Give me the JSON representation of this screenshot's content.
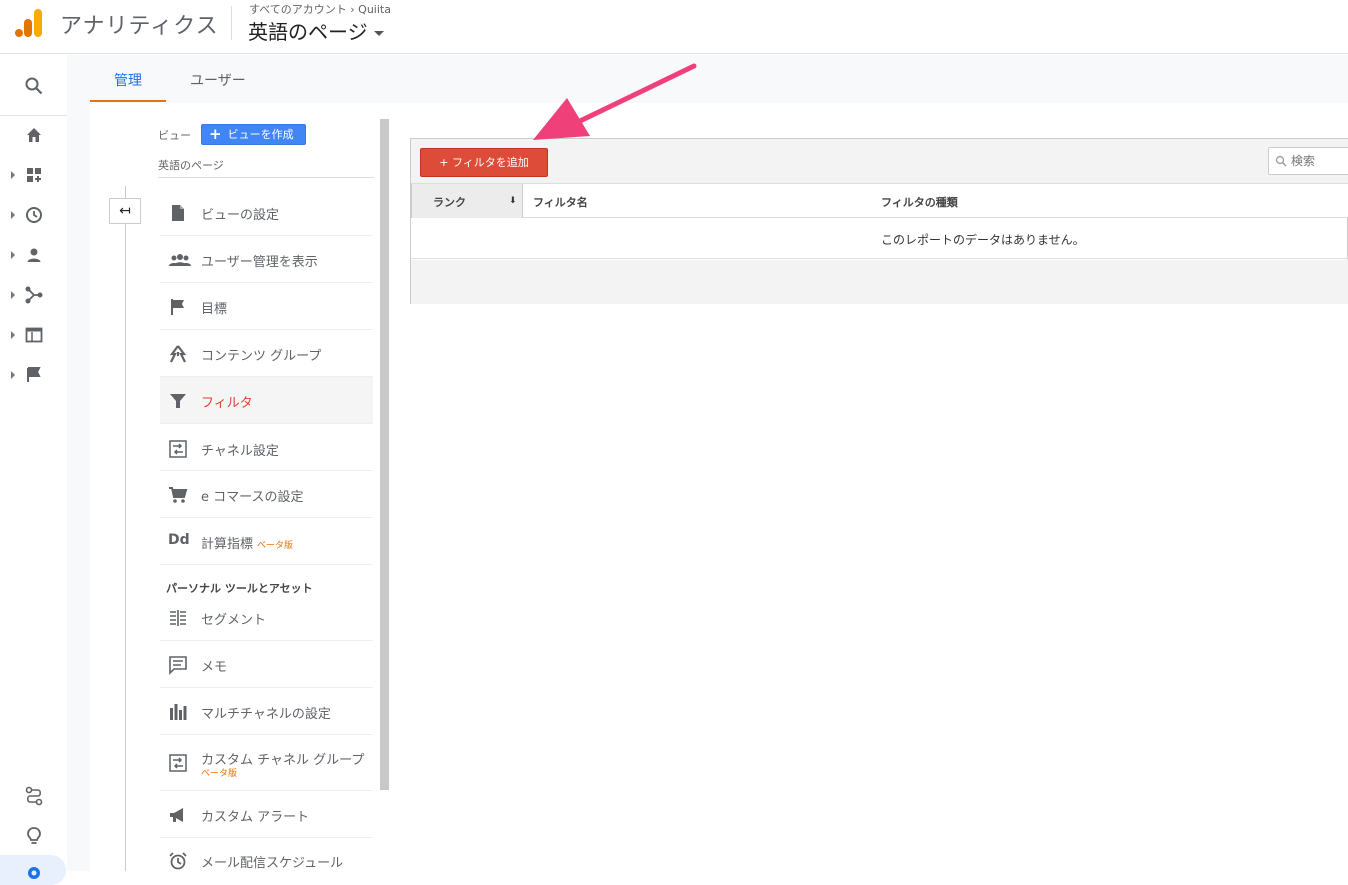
{
  "header": {
    "app_title": "アナリティクス",
    "breadcrumb": "すべてのアカウント › Quiita",
    "property_name": "英語のページ"
  },
  "tabs": [
    {
      "label": "管理",
      "active": true
    },
    {
      "label": "ユーザー",
      "active": false
    }
  ],
  "view_panel": {
    "view_label": "ビュー",
    "create_view_label": "ビューを作成",
    "view_name": "英語のページ",
    "section_personal": "パーソナル ツールとアセット",
    "beta_label": "ベータ版",
    "items": [
      {
        "label": "ビューの設定",
        "icon": "document-icon"
      },
      {
        "label": "ユーザー管理を表示",
        "icon": "people-icon"
      },
      {
        "label": "目標",
        "icon": "flag-icon"
      },
      {
        "label": "コンテンツ グループ",
        "icon": "content-group-icon"
      },
      {
        "label": "フィルタ",
        "icon": "filter-icon",
        "active": true
      },
      {
        "label": "チャネル設定",
        "icon": "channel-icon"
      },
      {
        "label": "e コマースの設定",
        "icon": "cart-icon"
      },
      {
        "label": "計算指標",
        "icon": "dd-icon",
        "beta": true
      }
    ],
    "personal_items": [
      {
        "label": "セグメント",
        "icon": "segment-icon"
      },
      {
        "label": "メモ",
        "icon": "memo-icon"
      },
      {
        "label": "マルチチャネルの設定",
        "icon": "multichannel-icon"
      },
      {
        "label": "カスタム チャネル グループ",
        "icon": "custom-channel-icon",
        "beta": true
      },
      {
        "label": "カスタム アラート",
        "icon": "megaphone-icon"
      },
      {
        "label": "メール配信スケジュール",
        "icon": "alarm-clock-icon"
      }
    ],
    "dd_text": "Dd"
  },
  "filters": {
    "add_button_label": "+ フィルタを追加",
    "search_placeholder": "検索",
    "columns": [
      "ランク",
      "フィルタ名",
      "フィルタの種類"
    ],
    "empty_message": "このレポートのデータはありません。"
  },
  "colors": {
    "accent_blue": "#1a73e8",
    "active_red": "#db4437",
    "add_button": "#dd4b39",
    "annotation_arrow": "#f0407a"
  }
}
